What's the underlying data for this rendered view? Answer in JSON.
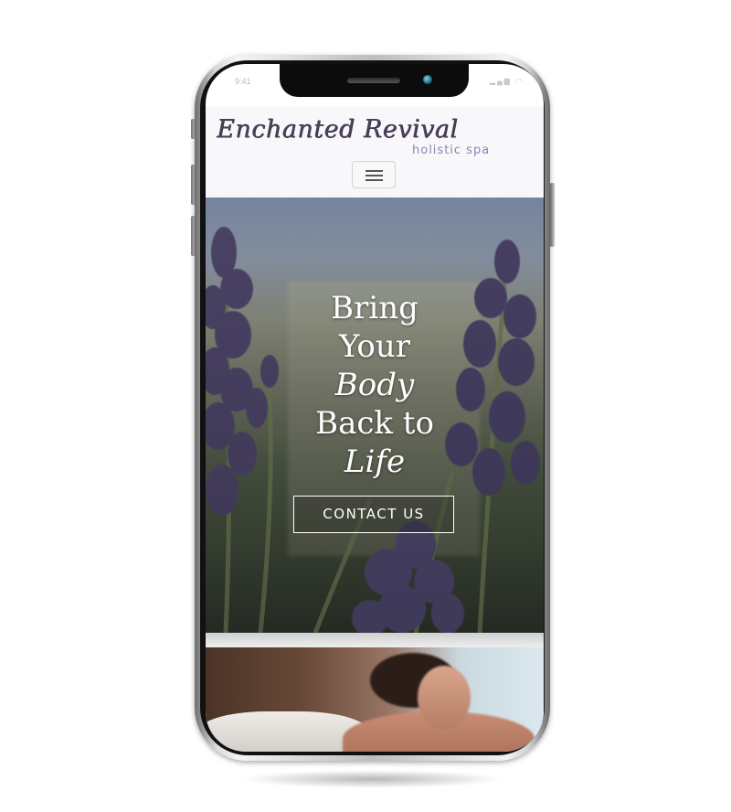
{
  "status_bar": {
    "time": "9:41",
    "icons": "▂▄▆ ◠"
  },
  "header": {
    "logo_title": "Enchanted Revival",
    "logo_subtitle": "holistic spa",
    "menu_icon": "hamburger-icon"
  },
  "hero": {
    "title_line1": "Bring",
    "title_line2": "Your",
    "title_line3": "Body",
    "title_line4": "Back to",
    "title_line5": "Life",
    "button_label": "CONTACT US",
    "background": "lavender-flowers"
  },
  "section2": {
    "image": "massage-spa-photo"
  },
  "colors": {
    "logo": "#4b3f56",
    "logo_sub": "#8a84b8",
    "header_bg": "#f8f8fa",
    "lavender": "#4d4468"
  }
}
